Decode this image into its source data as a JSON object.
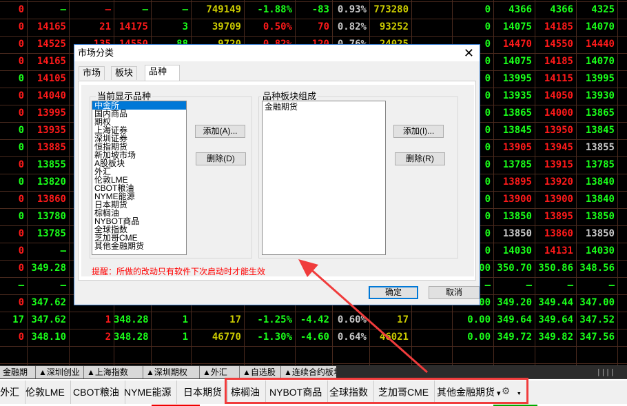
{
  "colors": {
    "r": "#ff1a1a",
    "g": "#1aff1a",
    "y": "#cccc00",
    "w": "#c8c8c8",
    "highlight": "#f03c3c",
    "selection": "#0078d7"
  },
  "table": {
    "rows": [
      [
        [
          "0",
          "r"
        ],
        [
          "—",
          "g"
        ],
        [
          "—",
          "r"
        ],
        [
          "—",
          "g"
        ],
        [
          "—",
          "g"
        ],
        [
          "749149",
          "y"
        ],
        [
          "-1.88%",
          "g"
        ],
        [
          "-83",
          "g"
        ],
        [
          "0.93%",
          "w"
        ],
        [
          "773280",
          "y"
        ],
        [
          "",
          ""
        ],
        [
          "0",
          "g"
        ],
        [
          "4366",
          "g"
        ],
        [
          "4366",
          "g"
        ],
        [
          "4325",
          "g"
        ]
      ],
      [
        [
          "0",
          "r"
        ],
        [
          "14165",
          "r"
        ],
        [
          "21",
          "r"
        ],
        [
          "14175",
          "r"
        ],
        [
          "3",
          "g"
        ],
        [
          "39709",
          "y"
        ],
        [
          "0.50%",
          "r"
        ],
        [
          "70",
          "r"
        ],
        [
          "0.82%",
          "w"
        ],
        [
          "93252",
          "y"
        ],
        [
          "",
          ""
        ],
        [
          "0",
          "g"
        ],
        [
          "14075",
          "g"
        ],
        [
          "14185",
          "r"
        ],
        [
          "14070",
          "g"
        ]
      ],
      [
        [
          "0",
          "r"
        ],
        [
          "14525",
          "r"
        ],
        [
          "135",
          "r"
        ],
        [
          "14550",
          "r"
        ],
        [
          "88",
          "g"
        ],
        [
          "9720",
          "y"
        ],
        [
          "0.82%",
          "r"
        ],
        [
          "120",
          "r"
        ],
        [
          "0.76%",
          "w"
        ],
        [
          "24025",
          "y"
        ],
        [
          "",
          ""
        ],
        [
          "0",
          "g"
        ],
        [
          "14470",
          "r"
        ],
        [
          "14550",
          "r"
        ],
        [
          "14440",
          "r"
        ]
      ],
      [
        [
          "0",
          "r"
        ],
        [
          "14165",
          "r"
        ],
        [
          "",
          "r"
        ],
        [
          "",
          "r"
        ],
        [
          "",
          "g"
        ],
        [
          "",
          "y"
        ],
        [
          "",
          "r"
        ],
        [
          "",
          "r"
        ],
        [
          "",
          "w"
        ],
        [
          "",
          "y"
        ],
        [
          "",
          ""
        ],
        [
          "0",
          "g"
        ],
        [
          "14075",
          "g"
        ],
        [
          "14185",
          "r"
        ],
        [
          "14070",
          "g"
        ]
      ],
      [
        [
          "0",
          "g"
        ],
        [
          "14105",
          "r"
        ],
        [
          "",
          ""
        ],
        [
          "",
          ""
        ],
        [
          "",
          ""
        ],
        [
          "",
          ""
        ],
        [
          "",
          ""
        ],
        [
          "",
          ""
        ],
        [
          "",
          ""
        ],
        [
          "",
          ""
        ],
        [
          "",
          ""
        ],
        [
          "0",
          "g"
        ],
        [
          "13995",
          "g"
        ],
        [
          "14115",
          "r"
        ],
        [
          "13995",
          "g"
        ]
      ],
      [
        [
          "0",
          "r"
        ],
        [
          "14040",
          "r"
        ],
        [
          "",
          ""
        ],
        [
          "",
          ""
        ],
        [
          "",
          ""
        ],
        [
          "",
          ""
        ],
        [
          "",
          ""
        ],
        [
          "",
          ""
        ],
        [
          "",
          ""
        ],
        [
          "",
          ""
        ],
        [
          "",
          ""
        ],
        [
          "0",
          "g"
        ],
        [
          "13935",
          "g"
        ],
        [
          "14050",
          "r"
        ],
        [
          "13930",
          "g"
        ]
      ],
      [
        [
          "0",
          "r"
        ],
        [
          "13995",
          "r"
        ],
        [
          "",
          ""
        ],
        [
          "",
          ""
        ],
        [
          "",
          ""
        ],
        [
          "",
          ""
        ],
        [
          "",
          ""
        ],
        [
          "",
          ""
        ],
        [
          "",
          ""
        ],
        [
          "",
          ""
        ],
        [
          "",
          ""
        ],
        [
          "0",
          "g"
        ],
        [
          "13865",
          "g"
        ],
        [
          "14000",
          "r"
        ],
        [
          "13865",
          "g"
        ]
      ],
      [
        [
          "0",
          "g"
        ],
        [
          "13935",
          "r"
        ],
        [
          "",
          ""
        ],
        [
          "",
          ""
        ],
        [
          "",
          ""
        ],
        [
          "",
          ""
        ],
        [
          "",
          ""
        ],
        [
          "",
          ""
        ],
        [
          "",
          ""
        ],
        [
          "",
          ""
        ],
        [
          "",
          ""
        ],
        [
          "0",
          "g"
        ],
        [
          "13845",
          "g"
        ],
        [
          "13950",
          "r"
        ],
        [
          "13845",
          "g"
        ]
      ],
      [
        [
          "0",
          "g"
        ],
        [
          "13885",
          "r"
        ],
        [
          "",
          ""
        ],
        [
          "",
          ""
        ],
        [
          "",
          ""
        ],
        [
          "",
          ""
        ],
        [
          "",
          ""
        ],
        [
          "",
          ""
        ],
        [
          "",
          ""
        ],
        [
          "",
          ""
        ],
        [
          "",
          ""
        ],
        [
          "0",
          "g"
        ],
        [
          "13905",
          "r"
        ],
        [
          "13945",
          "r"
        ],
        [
          "13855",
          "w"
        ]
      ],
      [
        [
          "0",
          "r"
        ],
        [
          "13855",
          "g"
        ],
        [
          "",
          ""
        ],
        [
          "",
          ""
        ],
        [
          "",
          ""
        ],
        [
          "",
          ""
        ],
        [
          "",
          ""
        ],
        [
          "",
          ""
        ],
        [
          "",
          ""
        ],
        [
          "",
          ""
        ],
        [
          "",
          ""
        ],
        [
          "0",
          "g"
        ],
        [
          "13785",
          "g"
        ],
        [
          "13915",
          "r"
        ],
        [
          "13785",
          "g"
        ]
      ],
      [
        [
          "0",
          "g"
        ],
        [
          "13820",
          "g"
        ],
        [
          "",
          ""
        ],
        [
          "",
          ""
        ],
        [
          "",
          ""
        ],
        [
          "",
          ""
        ],
        [
          "",
          ""
        ],
        [
          "",
          ""
        ],
        [
          "",
          ""
        ],
        [
          "",
          ""
        ],
        [
          "",
          ""
        ],
        [
          "0",
          "g"
        ],
        [
          "13895",
          "r"
        ],
        [
          "13920",
          "r"
        ],
        [
          "13840",
          "g"
        ]
      ],
      [
        [
          "0",
          "r"
        ],
        [
          "13860",
          "r"
        ],
        [
          "",
          ""
        ],
        [
          "",
          ""
        ],
        [
          "",
          ""
        ],
        [
          "",
          ""
        ],
        [
          "",
          ""
        ],
        [
          "",
          ""
        ],
        [
          "",
          ""
        ],
        [
          "",
          ""
        ],
        [
          "",
          ""
        ],
        [
          "0",
          "g"
        ],
        [
          "13900",
          "r"
        ],
        [
          "13900",
          "r"
        ],
        [
          "13840",
          "g"
        ]
      ],
      [
        [
          "0",
          "g"
        ],
        [
          "13780",
          "g"
        ],
        [
          "",
          ""
        ],
        [
          "",
          ""
        ],
        [
          "",
          ""
        ],
        [
          "",
          ""
        ],
        [
          "",
          ""
        ],
        [
          "",
          ""
        ],
        [
          "",
          ""
        ],
        [
          "",
          ""
        ],
        [
          "",
          ""
        ],
        [
          "0",
          "g"
        ],
        [
          "13850",
          "g"
        ],
        [
          "13895",
          "r"
        ],
        [
          "13850",
          "g"
        ]
      ],
      [
        [
          "0",
          "r"
        ],
        [
          "13785",
          "g"
        ],
        [
          "",
          ""
        ],
        [
          "",
          ""
        ],
        [
          "",
          ""
        ],
        [
          "",
          ""
        ],
        [
          "",
          ""
        ],
        [
          "",
          ""
        ],
        [
          "",
          ""
        ],
        [
          "",
          ""
        ],
        [
          "",
          ""
        ],
        [
          "0",
          "g"
        ],
        [
          "13850",
          "w"
        ],
        [
          "13860",
          "r"
        ],
        [
          "13850",
          "w"
        ]
      ],
      [
        [
          "0",
          "r"
        ],
        [
          "—",
          "g"
        ],
        [
          "",
          ""
        ],
        [
          "",
          ""
        ],
        [
          "",
          ""
        ],
        [
          "",
          ""
        ],
        [
          "",
          ""
        ],
        [
          "",
          ""
        ],
        [
          "",
          ""
        ],
        [
          "",
          ""
        ],
        [
          "",
          ""
        ],
        [
          "0",
          "g"
        ],
        [
          "14030",
          "g"
        ],
        [
          "14131",
          "r"
        ],
        [
          "14030",
          "g"
        ]
      ],
      [
        [
          "0",
          "r"
        ],
        [
          "349.28",
          "g"
        ],
        [
          "",
          ""
        ],
        [
          "",
          ""
        ],
        [
          "",
          ""
        ],
        [
          "",
          ""
        ],
        [
          "",
          ""
        ],
        [
          "",
          ""
        ],
        [
          "",
          ""
        ],
        [
          "",
          ""
        ],
        [
          "",
          ""
        ],
        [
          "0.00",
          "g"
        ],
        [
          "350.70",
          "g"
        ],
        [
          "350.86",
          "g"
        ],
        [
          "348.56",
          "g"
        ]
      ],
      [
        [
          "—",
          "g"
        ],
        [
          "—",
          "g"
        ],
        [
          "",
          ""
        ],
        [
          "",
          ""
        ],
        [
          "",
          ""
        ],
        [
          "",
          ""
        ],
        [
          "",
          ""
        ],
        [
          "",
          ""
        ],
        [
          "",
          ""
        ],
        [
          "",
          ""
        ],
        [
          "",
          ""
        ],
        [
          "—",
          "g"
        ],
        [
          "—",
          "g"
        ],
        [
          "—",
          "g"
        ],
        [
          "—",
          "g"
        ]
      ],
      [
        [
          "0",
          "r"
        ],
        [
          "347.62",
          "g"
        ],
        [
          "",
          ""
        ],
        [
          "",
          ""
        ],
        [
          "",
          ""
        ],
        [
          "",
          ""
        ],
        [
          "",
          ""
        ],
        [
          "",
          ""
        ],
        [
          "",
          ""
        ],
        [
          "",
          ""
        ],
        [
          "",
          ""
        ],
        [
          "0.00",
          "g"
        ],
        [
          "349.20",
          "g"
        ],
        [
          "349.44",
          "g"
        ],
        [
          "347.00",
          "g"
        ]
      ],
      [
        [
          "17",
          "g"
        ],
        [
          "347.62",
          "g"
        ],
        [
          "1",
          "r"
        ],
        [
          "348.28",
          "g"
        ],
        [
          "1",
          "g"
        ],
        [
          "17",
          "y"
        ],
        [
          "-1.25%",
          "g"
        ],
        [
          "-4.42",
          "g"
        ],
        [
          "0.60%",
          "w"
        ],
        [
          "17",
          "y"
        ],
        [
          "",
          ""
        ],
        [
          "0.00",
          "g"
        ],
        [
          "349.64",
          "g"
        ],
        [
          "349.64",
          "g"
        ],
        [
          "347.52",
          "g"
        ]
      ],
      [
        [
          "0",
          "r"
        ],
        [
          "348.10",
          "g"
        ],
        [
          "2",
          "r"
        ],
        [
          "348.28",
          "g"
        ],
        [
          "1",
          "g"
        ],
        [
          "46770",
          "y"
        ],
        [
          "-1.30%",
          "g"
        ],
        [
          "-4.60",
          "g"
        ],
        [
          "0.64%",
          "w"
        ],
        [
          "46021",
          "y"
        ],
        [
          "",
          ""
        ],
        [
          "0.00",
          "g"
        ],
        [
          "349.72",
          "g"
        ],
        [
          "349.82",
          "g"
        ],
        [
          "347.56",
          "g"
        ]
      ]
    ]
  },
  "sheet_tabs": [
    "金融期货",
    "▲深圳创业",
    "▲上海指数",
    "▲深圳期权",
    "▲外汇",
    "▲自选股",
    "▲连续合约板块"
  ],
  "sheet_scroll_grip": "||||",
  "toolbar": {
    "items": [
      "外汇",
      "伦敦LME",
      "CBOT粮油",
      "NYME能源",
      "日本期货",
      "棕榈油",
      "NYBOT商品",
      "全球指数",
      "芝加哥CME",
      "其他金融期货"
    ],
    "dropdown_arrow": "▾",
    "more_arrow": "▾",
    "gear_icon": "gear-icon"
  },
  "dialog": {
    "title": "市场分类",
    "close": "✕",
    "tabs": [
      "市场",
      "板块",
      "品种"
    ],
    "active_tab": 2,
    "left_group": {
      "label": "当前显示品种",
      "items": [
        "中金所",
        "国内商品",
        "期权",
        "上海证券",
        "深圳证券",
        "恒指期货",
        "新加坡市场",
        "A股板块",
        "外汇",
        "伦敦LME",
        "CBOT粮油",
        "NYME能源",
        "日本期货",
        "棕榈油",
        "NYBOT商品",
        "全球指数",
        "芝加哥CME",
        "其他金融期货"
      ],
      "selected": 0,
      "add_button": "添加(A)...",
      "delete_button": "删除(D)"
    },
    "right_group": {
      "label": "品种板块组成",
      "items": [
        "金融期货"
      ],
      "add_button": "添加(I)...",
      "delete_button": "删除(R)"
    },
    "hint": "提醒：所做的改动只有软件下次启动时才能生效",
    "ok_button": "确定",
    "cancel_button": "取消"
  }
}
